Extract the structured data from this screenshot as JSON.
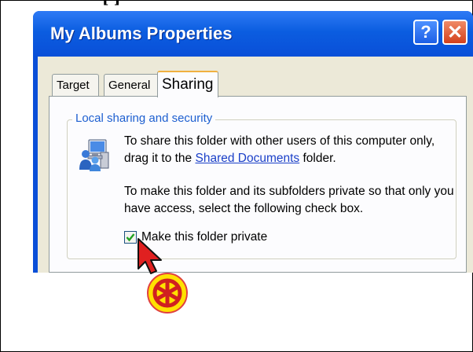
{
  "header_cutoff": "[ ]",
  "window": {
    "title": "My Albums Properties",
    "help_label": "?",
    "close_label": "✕"
  },
  "tabs": [
    {
      "label": "Target",
      "selected": false
    },
    {
      "label": "General",
      "selected": false
    },
    {
      "label": "Sharing",
      "selected": true
    }
  ],
  "sharing": {
    "group_legend": "Local sharing and security",
    "para1_before": "To share this folder with other users of this computer only, drag it to the ",
    "link_text": "Shared Documents",
    "para1_after": " folder.",
    "para2": "To make this folder and its subfolders private so that only you have access, select the following check box.",
    "private_checkbox": {
      "label": "Make this folder private",
      "checked": true
    }
  },
  "icons": {
    "help": "help-icon",
    "close": "close-icon",
    "sharing": "computer-users-icon",
    "cursor": "mouse-cursor-icon",
    "click_marker": "click-marker-icon"
  },
  "colors": {
    "titlebar": "#0a4fd8",
    "client_background": "#ece9d8",
    "link": "#1a3fc8",
    "close_button": "#d4401c",
    "click_marker": "#ffe100",
    "cursor": "#e02020"
  }
}
